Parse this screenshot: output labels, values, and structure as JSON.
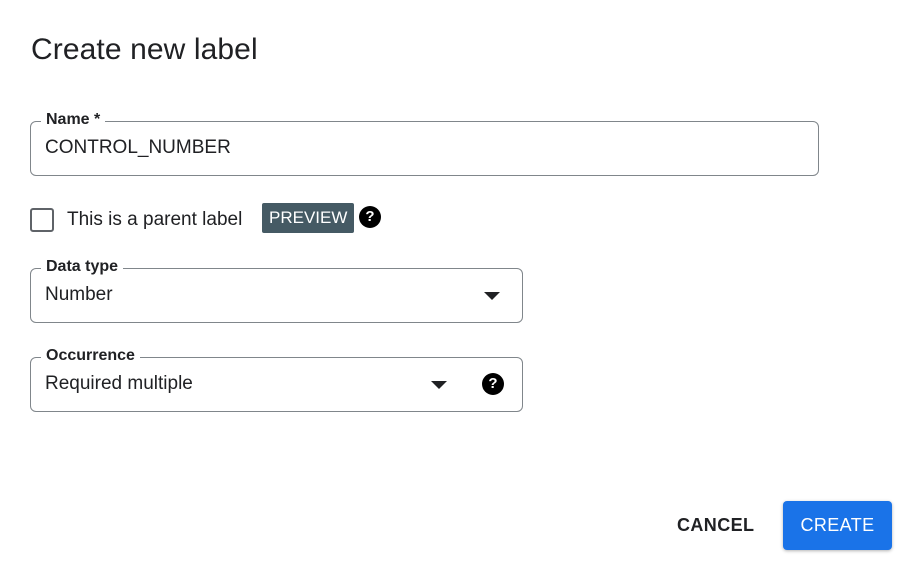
{
  "dialog": {
    "title": "Create new label"
  },
  "name_field": {
    "label": "Name *",
    "value": "CONTROL_NUMBER"
  },
  "parent_label": {
    "checked": false,
    "label": "This is a parent label",
    "badge": "PREVIEW",
    "help_icon": "help-circle-icon"
  },
  "data_type_field": {
    "label": "Data type",
    "selected": "Number",
    "icon": "dropdown-arrow-icon"
  },
  "occurrence_field": {
    "label": "Occurrence",
    "selected": "Required multiple",
    "icon": "dropdown-arrow-icon",
    "help_icon": "help-circle-icon"
  },
  "actions": {
    "cancel_label": "CANCEL",
    "create_label": "CREATE"
  },
  "colors": {
    "primary": "#1a73e8",
    "badge_bg": "#455a64",
    "border": "#80868b",
    "text": "#202124"
  }
}
